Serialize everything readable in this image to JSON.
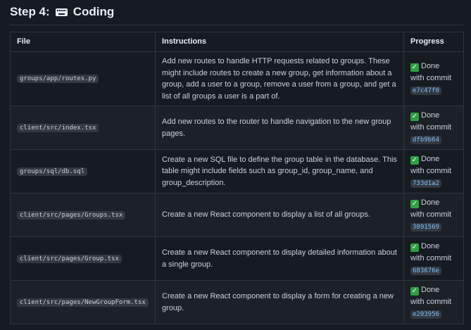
{
  "heading": {
    "step": "Step 4:",
    "icon": "keyboard-icon",
    "label": "Coding"
  },
  "table": {
    "headers": [
      "File",
      "Instructions",
      "Progress"
    ],
    "rows": [
      {
        "file": "groups/app/routes.py",
        "instructions": "Add new routes to handle HTTP requests related to groups. These might include routes to create a new group, get information about a group, add a user to a group, remove a user from a group, and get a list of all groups a user is a part of.",
        "status": "Done",
        "commit_label": "with commit",
        "commit": "e7c47f0"
      },
      {
        "file": "client/src/index.tsx",
        "instructions": "Add new routes to the router to handle navigation to the new group pages.",
        "status": "Done",
        "commit_label": "with commit",
        "commit": "dfb9b64"
      },
      {
        "file": "groups/sql/db.sql",
        "instructions": "Create a new SQL file to define the group table in the database. This table might include fields such as group_id, group_name, and group_description.",
        "status": "Done",
        "commit_label": "with commit",
        "commit": "733d1a2"
      },
      {
        "file": "client/src/pages/Groups.tsx",
        "instructions": "Create a new React component to display a list of all groups.",
        "status": "Done",
        "commit_label": "with commit",
        "commit": "3891569"
      },
      {
        "file": "client/src/pages/Group.tsx",
        "instructions": "Create a new React component to display detailed information about a single group.",
        "status": "Done",
        "commit_label": "with commit",
        "commit": "683676e"
      },
      {
        "file": "client/src/pages/NewGroupForm.tsx",
        "instructions": "Create a new React component to display a form for creating a new group.",
        "status": "Done",
        "commit_label": "with commit",
        "commit": "e203956"
      }
    ]
  },
  "colors": {
    "background": "#161b22",
    "border": "#30363d",
    "check": "#2ea043",
    "commit_link": "#79c0ff"
  }
}
